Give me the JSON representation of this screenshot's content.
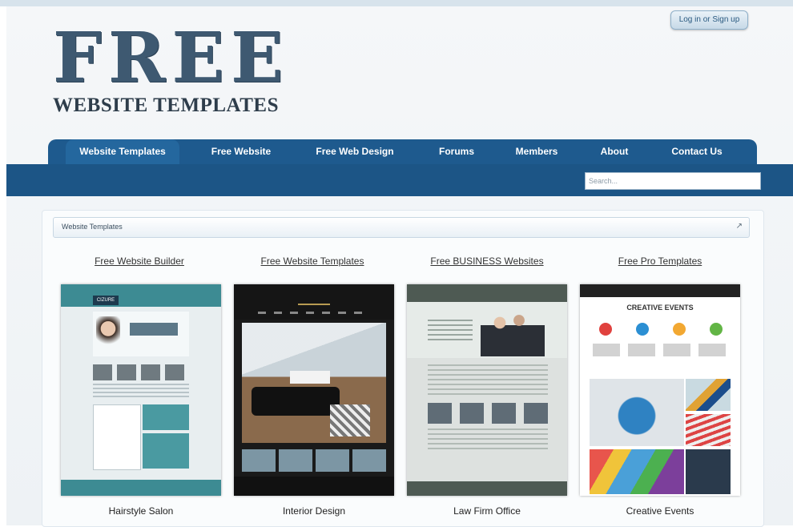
{
  "header": {
    "logo_big": "FREE",
    "logo_small": "WEBSITE TEMPLATES",
    "login_label": "Log in or Sign up"
  },
  "nav": {
    "items": [
      {
        "label": "Website Templates",
        "active": true
      },
      {
        "label": "Free Website",
        "active": false
      },
      {
        "label": "Free Web Design",
        "active": false
      },
      {
        "label": "Forums",
        "active": false
      },
      {
        "label": "Members",
        "active": false
      },
      {
        "label": "About",
        "active": false
      },
      {
        "label": "Contact Us",
        "active": false
      }
    ],
    "search_placeholder": "Search..."
  },
  "section": {
    "title": "Website Templates",
    "close_glyph": "↗"
  },
  "templates": [
    {
      "link": "Free Website Builder",
      "caption": "Hairstyle Salon",
      "thumb_text": "CIZURE"
    },
    {
      "link": "Free Website Templates",
      "caption": "Interior Design"
    },
    {
      "link": "Free BUSINESS Websites",
      "caption": "Law Firm Office"
    },
    {
      "link": "Free Pro Templates",
      "caption": "Creative Events",
      "thumb_text": "CREATIVE EVENTS"
    }
  ],
  "colors": {
    "nav_blue": "#1e5a8e",
    "logo_blue": "#3e5971"
  }
}
